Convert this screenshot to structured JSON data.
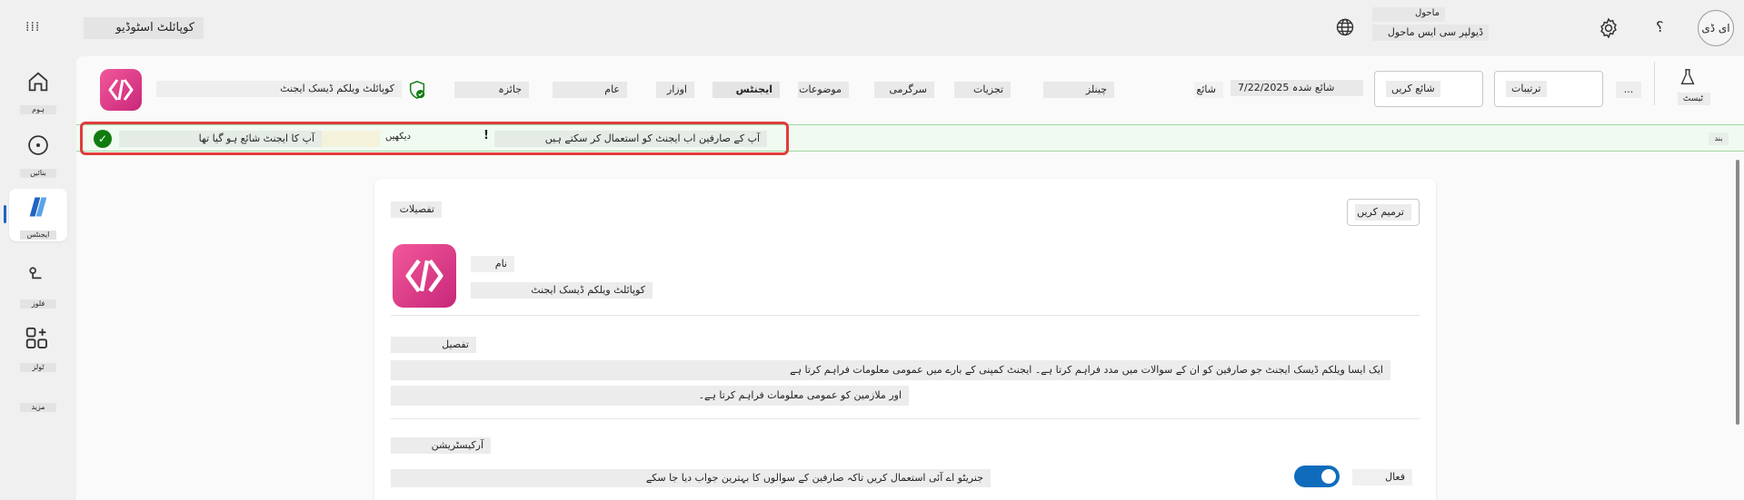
{
  "topbar": {
    "waffle_icon": "waffle-grid-icon",
    "app_name": "کوپائلٹ اسٹوڈیو",
    "environment_label": "ماحول",
    "environment_name": "ڈیولپر سی ایس ماحول",
    "help": "؟",
    "avatar": "ای ڈی"
  },
  "rail": {
    "items": [
      {
        "label": "ہوم",
        "icon": "home-icon"
      },
      {
        "label": "بنائیں",
        "icon": "create-icon"
      },
      {
        "label": "ایجنٹس",
        "icon": "agents-icon"
      },
      {
        "label": "فلوز",
        "icon": "flows-icon"
      },
      {
        "label": "ٹولز",
        "icon": "tools-icon"
      },
      {
        "label": "مزید",
        "icon": "more-icon"
      }
    ]
  },
  "command_bar": {
    "agent_name": "کوپائلٹ ویلکم ڈیسک ایجنٹ",
    "overview": "جائزہ",
    "tabs": [
      "عام",
      "ایجنٹس",
      "اوزار",
      "موضوعات",
      "سرگرمی",
      "تجزیات",
      "چینلز"
    ],
    "active_tab": "ایجنٹس",
    "publish_status": "شائع",
    "publish_date": "شائع شدہ 7/22/2025",
    "more": "...",
    "settings_button": "ترتیبات",
    "publish_button": "شائع کریں",
    "test_button": "ٹیسٹ"
  },
  "notification": {
    "message": "آپ کا ایجنٹ شائع ہو گیا تھا",
    "link": "دیکھیں",
    "separator": "!",
    "detail": "آپ کے صارفین اب ایجنٹ کو استعمال کر سکتے ہیں",
    "close": "بند"
  },
  "card": {
    "title": "تفصیلات",
    "edit_button": "ترمیم کریں",
    "name_label": "نام",
    "name_value": "کوپائلٹ ویلکم ڈیسک ایجنٹ",
    "description_label": "تفصیل",
    "description_line1": "ایک ایسا ویلکم ڈیسک ایجنٹ جو صارفین کو ان کے سوالات میں مدد فراہم کرتا ہے۔ ایجنٹ کمپنی کے بارے میں عمومی معلومات فراہم کرتا ہے",
    "description_line2": "اور ملازمین کو عمومی معلومات فراہم کرتا ہے۔",
    "orchestration_label": "آرکیسٹریشن",
    "orchestration_desc": "جنریٹو اے آئی استعمال کریں تاکہ صارفین کے سوالوں کا بہترین جواب دیا جا سکے",
    "toggle_label": "فعال",
    "toggle_on": true
  },
  "colors": {
    "accent": "#0f6cbd",
    "success": "#107c10",
    "highlight": "#e03c3c",
    "brand_start": "#f2589a",
    "brand_end": "#c8277a"
  }
}
